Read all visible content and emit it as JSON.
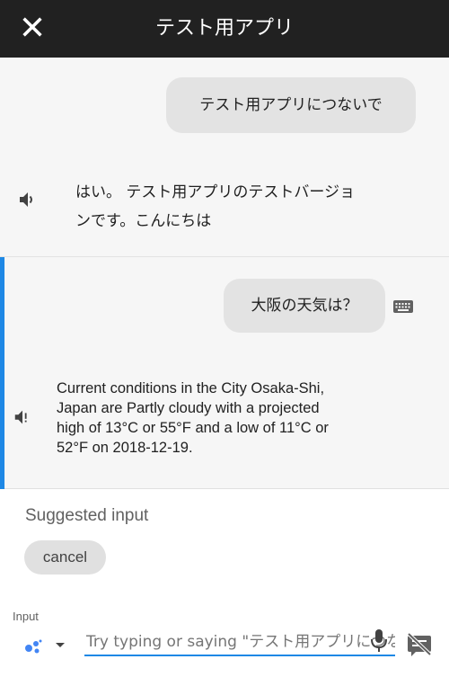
{
  "header": {
    "title": "テスト用アプリ",
    "close_icon": "close-icon"
  },
  "conversation": [
    {
      "role": "user",
      "text": "テスト用アプリにつないで",
      "input_method": "voice"
    },
    {
      "role": "assistant",
      "text_line1": "はい。 テスト用アプリのテストバージョ",
      "text_line2": "ンです。こんにちは",
      "icon": "speaker-icon"
    },
    {
      "role": "user",
      "text": "大阪の天気は？",
      "input_method": "keyboard",
      "icon": "keyboard-icon",
      "active": true
    },
    {
      "role": "assistant",
      "lines": [
        "Current conditions in the City Osaka-Shi,",
        "Japan are Partly cloudy with a projected",
        "high of 13°C or 55°F and a low of 11°C or",
        "52°F on 2018-12-19."
      ],
      "icon": "speaker-muted-icon"
    }
  ],
  "suggested": {
    "title": "Suggested input",
    "chips": [
      "cancel"
    ]
  },
  "input": {
    "label": "Input",
    "placeholder": "Try typing or saying \"テスト用アプリにつないで\"",
    "value": "",
    "assistant_icon": "assistant-dots-icon",
    "mic_icon": "microphone-icon",
    "no_keyboard_icon": "no-screen-icon"
  },
  "colors": {
    "header_bg": "#212121",
    "accent": "#1e88e5",
    "bubble_bg": "#e3e3e3",
    "conversation_bg": "#f6f6f6"
  }
}
